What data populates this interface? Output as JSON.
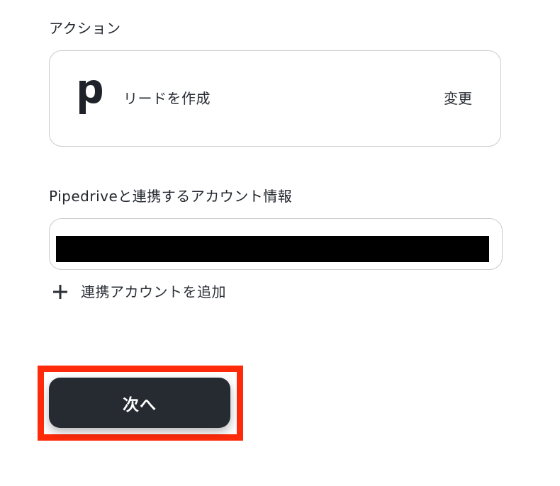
{
  "action_section": {
    "label": "アクション",
    "app_icon": "pipedrive-logo-icon",
    "action_name": "リードを作成",
    "change_label": "変更"
  },
  "account_section": {
    "label": "Pipedriveと連携するアカウント情報",
    "selected_value": "",
    "add_account_icon": "plus-icon",
    "add_account_label": "連携アカウントを追加"
  },
  "footer": {
    "next_label": "次へ"
  },
  "colors": {
    "button_bg": "#262a31",
    "highlight": "#ff2a0a",
    "border": "#c9cbcf"
  }
}
